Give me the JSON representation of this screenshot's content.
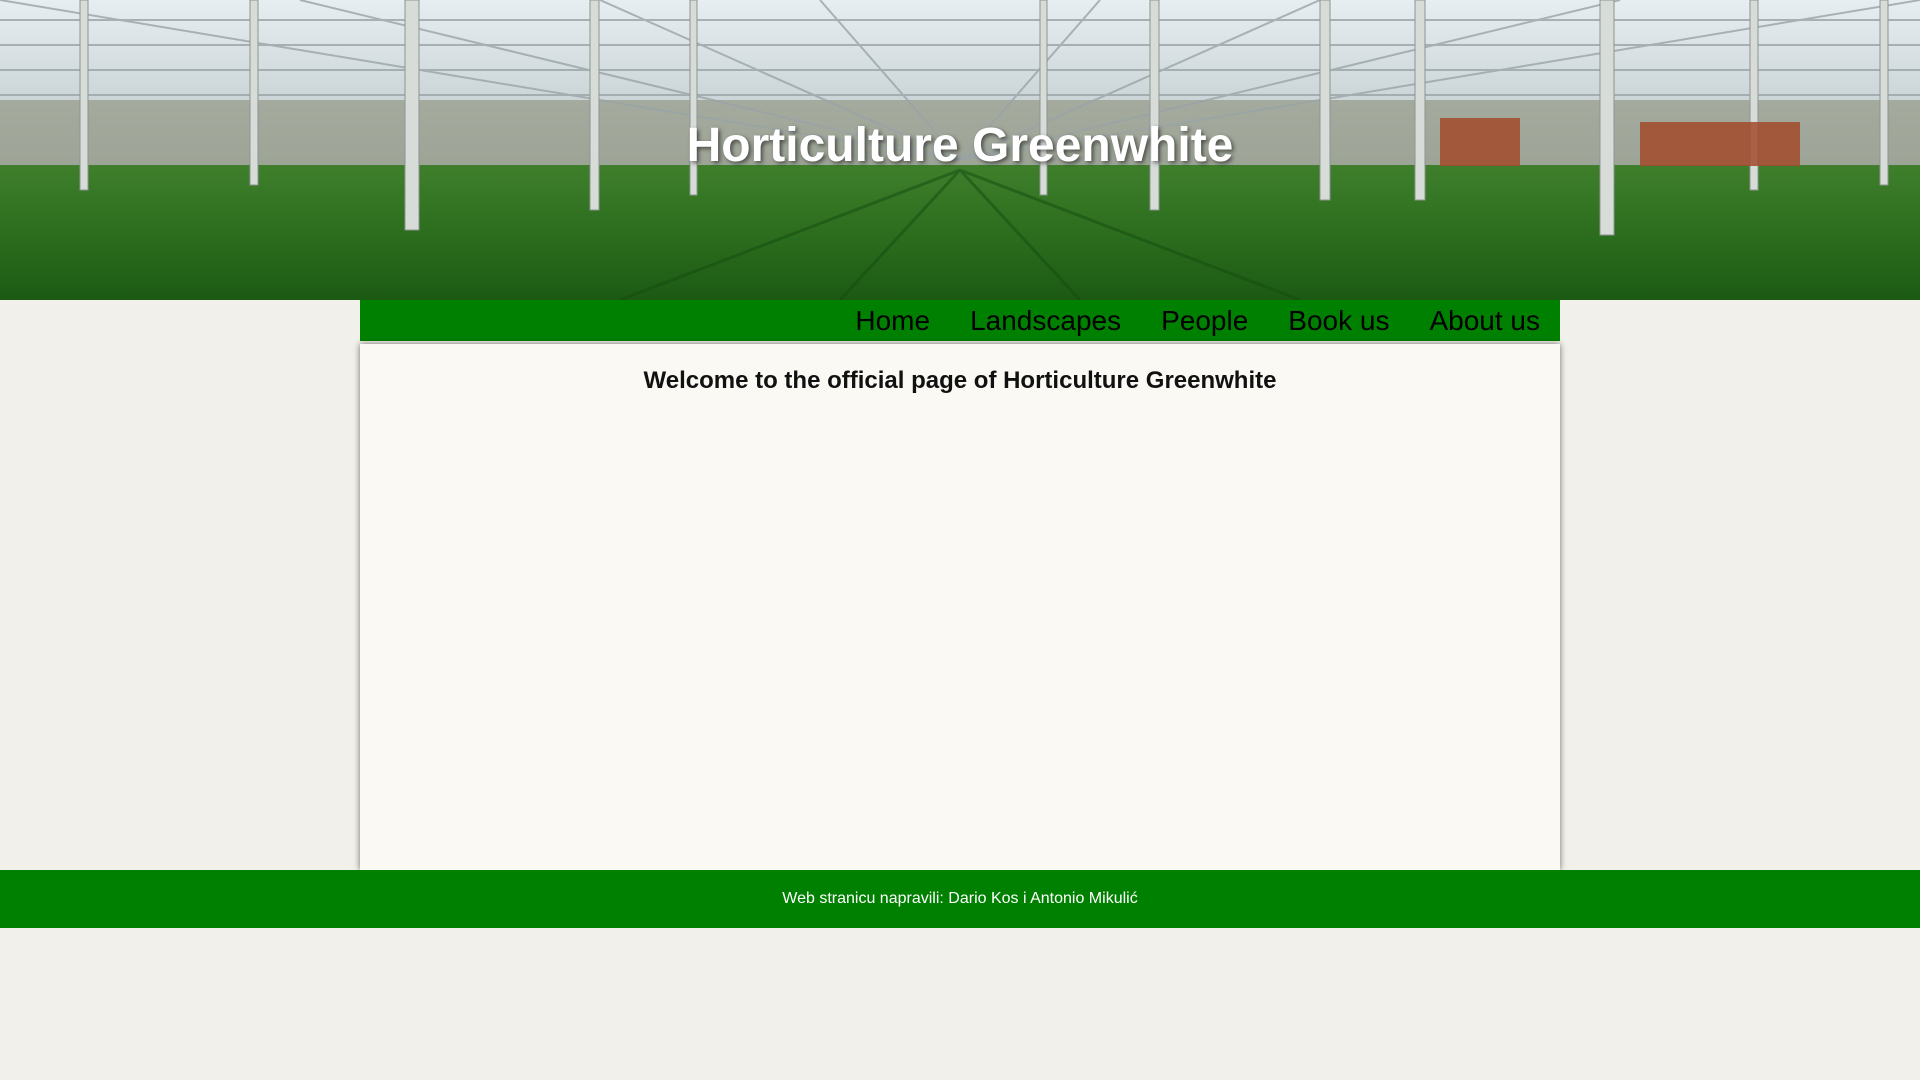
{
  "header": {
    "title": "Horticulture Greenwhite",
    "image_name": "greenhouse-photo"
  },
  "nav": {
    "items": [
      {
        "label": "Home"
      },
      {
        "label": "Landscapes"
      },
      {
        "label": "People"
      },
      {
        "label": "Book us"
      },
      {
        "label": "About us"
      }
    ]
  },
  "main": {
    "heading": "Welcome to the official page of Horticulture Greenwhite"
  },
  "footer": {
    "text": "Web stranicu napravili: Dario Kos i Antonio Mikulić"
  },
  "colors": {
    "accent": "#008000",
    "page_background": "#f1f0ea",
    "content_background": "#faf9f3"
  }
}
